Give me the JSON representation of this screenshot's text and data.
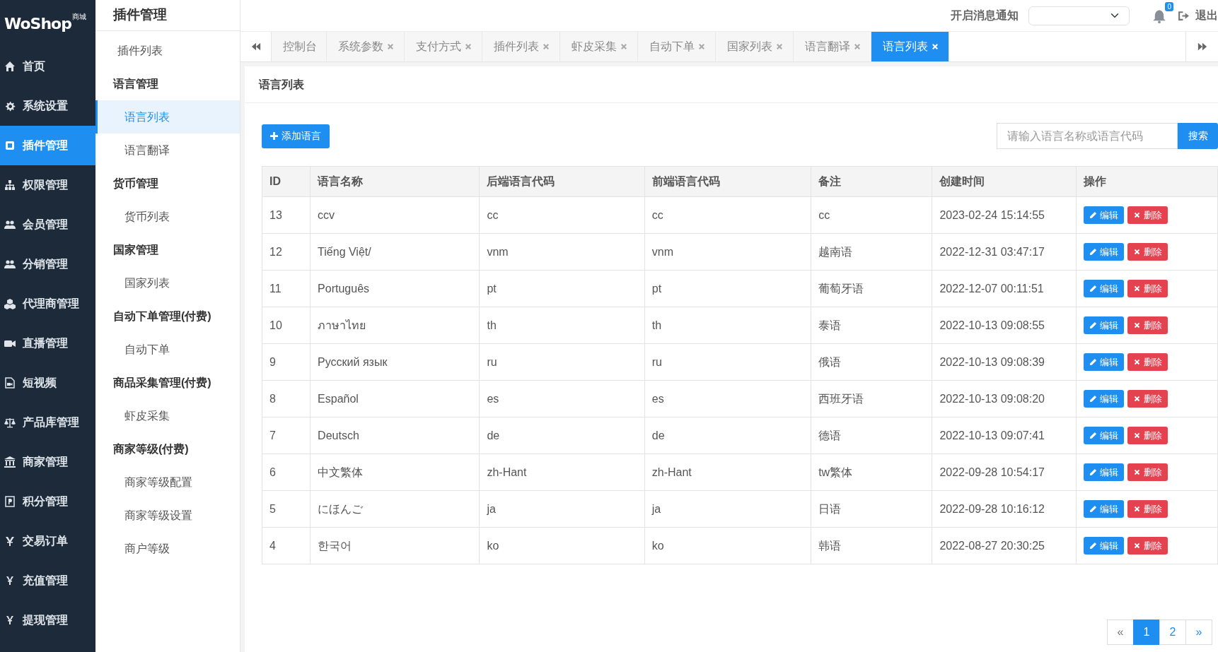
{
  "logo": {
    "text": "WoShop",
    "badge": "商城"
  },
  "main_menu": [
    {
      "label": "首页",
      "selected": false
    },
    {
      "label": "系统设置",
      "selected": false
    },
    {
      "label": "插件管理",
      "selected": true
    },
    {
      "label": "权限管理",
      "selected": false
    },
    {
      "label": "会员管理",
      "selected": false
    },
    {
      "label": "分销管理",
      "selected": false
    },
    {
      "label": "代理商管理",
      "selected": false
    },
    {
      "label": "直播管理",
      "selected": false
    },
    {
      "label": "短视频",
      "selected": false
    },
    {
      "label": "产品库管理",
      "selected": false
    },
    {
      "label": "商家管理",
      "selected": false
    },
    {
      "label": "积分管理",
      "selected": false
    },
    {
      "label": "交易订单",
      "selected": false
    },
    {
      "label": "充值管理",
      "selected": false
    },
    {
      "label": "提现管理",
      "selected": false
    }
  ],
  "sub_menu": {
    "title": "插件管理",
    "items": [
      {
        "label": "插件列表",
        "selected": false
      },
      {
        "label": "语言管理",
        "children": [
          {
            "label": "语言列表",
            "selected": true
          },
          {
            "label": "语言翻译",
            "selected": false
          }
        ]
      },
      {
        "label": "货币管理",
        "children": [
          {
            "label": "货币列表",
            "selected": false
          }
        ]
      },
      {
        "label": "国家管理",
        "children": [
          {
            "label": "国家列表",
            "selected": false
          }
        ]
      },
      {
        "label": "自动下单管理(付费)",
        "children": [
          {
            "label": "自动下单",
            "selected": false
          }
        ]
      },
      {
        "label": "商品采集管理(付费)",
        "children": [
          {
            "label": "虾皮采集",
            "selected": false
          }
        ]
      },
      {
        "label": "商家等级(付费)",
        "children": [
          {
            "label": "商家等级配置",
            "selected": false
          },
          {
            "label": "商家等级设置",
            "selected": false
          },
          {
            "label": "商户等级",
            "selected": false
          }
        ]
      }
    ]
  },
  "header": {
    "notify_label": "开启消息通知",
    "notification_count": "0",
    "logout": "退出"
  },
  "tabs": [
    {
      "label": "控制台",
      "closable": false,
      "selected": false
    },
    {
      "label": "系统参数",
      "closable": true,
      "selected": false
    },
    {
      "label": "支付方式",
      "closable": true,
      "selected": false
    },
    {
      "label": "插件列表",
      "closable": true,
      "selected": false
    },
    {
      "label": "虾皮采集",
      "closable": true,
      "selected": false
    },
    {
      "label": "自动下单",
      "closable": true,
      "selected": false
    },
    {
      "label": "国家列表",
      "closable": true,
      "selected": false
    },
    {
      "label": "语言翻译",
      "closable": true,
      "selected": false
    },
    {
      "label": "语言列表",
      "closable": true,
      "selected": true
    }
  ],
  "panel": {
    "title": "语言列表",
    "add_button": "添加语言",
    "search": {
      "placeholder": "请输入语言名称或语言代码",
      "button": "搜索"
    },
    "table": {
      "columns": [
        "ID",
        "语言名称",
        "后端语言代码",
        "前端语言代码",
        "备注",
        "创建时间",
        "操作"
      ],
      "rows": [
        {
          "cells": [
            "13",
            "ccv",
            "cc",
            "cc",
            "cc",
            "2023-02-24 15:14:55"
          ],
          "actions": [
            "编辑",
            "删除"
          ]
        },
        {
          "cells": [
            "12",
            "Tiếng Việt/",
            "vnm",
            "vnm",
            "越南语",
            "2022-12-31 03:47:17"
          ],
          "actions": [
            "编辑",
            "删除"
          ]
        },
        {
          "cells": [
            "11",
            "Português",
            "pt",
            "pt",
            "葡萄牙语",
            "2022-12-07 00:11:51"
          ],
          "actions": [
            "编辑",
            "删除"
          ]
        },
        {
          "cells": [
            "10",
            "ภาษาไทย",
            "th",
            "th",
            "泰语",
            "2022-10-13 09:08:55"
          ],
          "actions": [
            "编辑",
            "删除"
          ]
        },
        {
          "cells": [
            "9",
            "Русский язык",
            "ru",
            "ru",
            "俄语",
            "2022-10-13 09:08:39"
          ],
          "actions": [
            "编辑",
            "删除"
          ]
        },
        {
          "cells": [
            "8",
            "Español",
            "es",
            "es",
            "西班牙语",
            "2022-10-13 09:08:20"
          ],
          "actions": [
            "编辑",
            "删除"
          ]
        },
        {
          "cells": [
            "7",
            "Deutsch",
            "de",
            "de",
            "德语",
            "2022-10-13 09:07:41"
          ],
          "actions": [
            "编辑",
            "删除"
          ]
        },
        {
          "cells": [
            "6",
            "中文繁体",
            "zh-Hant",
            "zh-Hant",
            "tw繁体",
            "2022-09-28 10:54:17"
          ],
          "actions": [
            "编辑",
            "删除"
          ]
        },
        {
          "cells": [
            "5",
            "にほんご",
            "ja",
            "ja",
            "日语",
            "2022-09-28 10:16:12"
          ],
          "actions": [
            "编辑",
            "删除"
          ]
        },
        {
          "cells": [
            "4",
            "한국어",
            "ko",
            "ko",
            "韩语",
            "2022-08-27 20:30:25"
          ],
          "actions": [
            "编辑",
            "删除"
          ]
        }
      ]
    },
    "pagination": {
      "prev": "«",
      "pages": [
        {
          "label": "1",
          "selected": true
        },
        {
          "label": "2",
          "selected": false
        }
      ],
      "next": "»"
    }
  }
}
